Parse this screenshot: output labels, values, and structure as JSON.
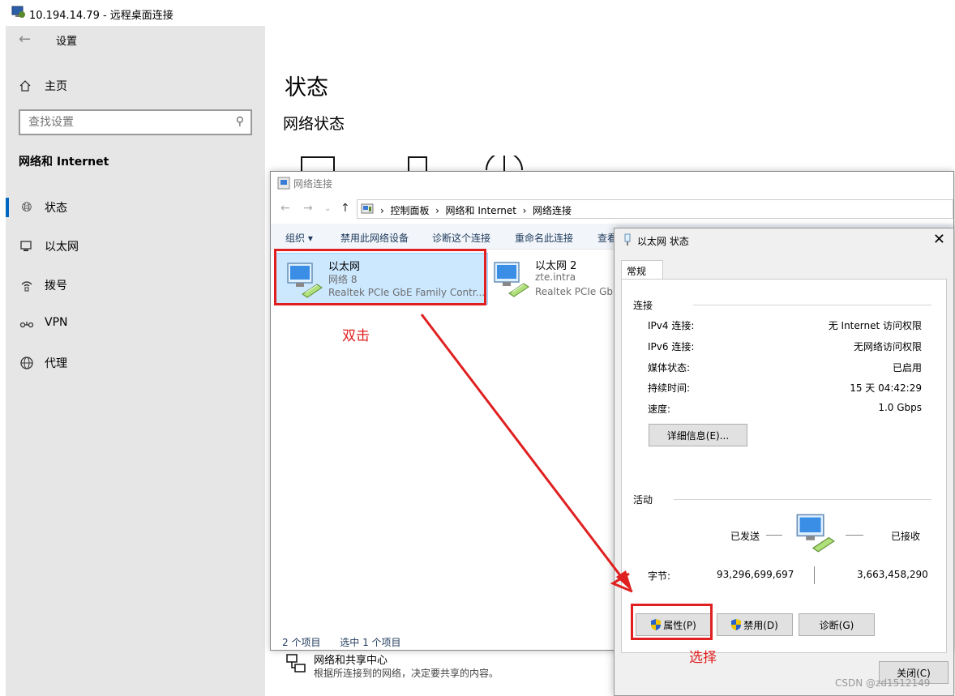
{
  "rdp": {
    "title": "10.194.14.79 - 远程桌面连接"
  },
  "settings": {
    "title": "设置",
    "home": "主页",
    "search_placeholder": "查找设置",
    "section": "网络和 Internet",
    "nav": [
      {
        "label": "状态",
        "icon": "globe-network-icon"
      },
      {
        "label": "以太网",
        "icon": "ethernet-monitor-icon"
      },
      {
        "label": "拨号",
        "icon": "dialup-icon"
      },
      {
        "label": "VPN",
        "icon": "vpn-icon"
      },
      {
        "label": "代理",
        "icon": "globe-icon"
      }
    ],
    "page_title": "状态",
    "network_status": "网络状态",
    "share_center_title": "网络和共享中心",
    "share_center_desc": "根据所连接到的网络，决定要共享的内容。"
  },
  "netconn": {
    "title": "网络连接",
    "breadcrumbs": [
      "控制面板",
      "网络和 Internet",
      "网络连接"
    ],
    "toolbar": [
      "组织 ▾",
      "禁用此网络设备",
      "诊断这个连接",
      "重命名此连接",
      "查看"
    ],
    "adapters": [
      {
        "name": "以太网",
        "network": "网络 8",
        "device": "Realtek PCIe GbE Family Contr..."
      },
      {
        "name": "以太网 2",
        "network": "zte.intra",
        "device": "Realtek PCIe GbE"
      }
    ],
    "status_count": "2 个项目",
    "status_selected": "选中 1 个项目"
  },
  "dialog": {
    "title": "以太网 状态",
    "tab": "常规",
    "group_connection": "连接",
    "rows": [
      {
        "k": "IPv4 连接:",
        "v": "无 Internet 访问权限"
      },
      {
        "k": "IPv6 连接:",
        "v": "无网络访问权限"
      },
      {
        "k": "媒体状态:",
        "v": "已启用"
      },
      {
        "k": "持续时间:",
        "v": "15 天 04:42:29"
      },
      {
        "k": "速度:",
        "v": "1.0 Gbps"
      }
    ],
    "details_btn": "详细信息(E)...",
    "group_activity": "活动",
    "sent": "已发送",
    "received": "已接收",
    "bytes_label": "字节:",
    "bytes_sent": "93,296,699,697",
    "bytes_received": "3,663,458,290",
    "btn_properties": "属性(P)",
    "btn_disable": "禁用(D)",
    "btn_diagnose": "诊断(G)",
    "btn_close": "关闭(C)"
  },
  "annotations": {
    "double_click": "双击",
    "select": "选择",
    "color": "#e02020"
  },
  "watermark": "CSDN @zd1512149"
}
